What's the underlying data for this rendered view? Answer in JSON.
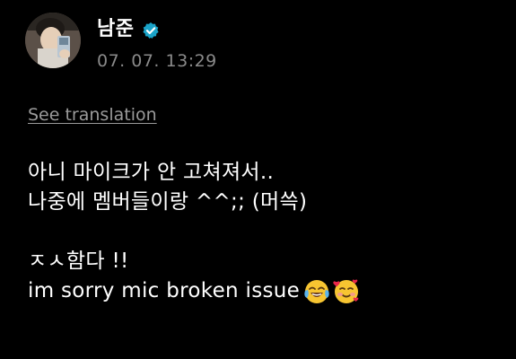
{
  "post": {
    "author_name": "남준",
    "verified": true,
    "timestamp": "07. 07. 13:29",
    "translation_link": "See translation",
    "lines": [
      "아니 마이크가 안 고쳐져서..",
      "나중에 멤버들이랑 ^^;; (머쓱)",
      "",
      "ㅈㅅ함다 !!",
      "im sorry mic broken issue"
    ],
    "emojis": [
      "face-with-tears-of-joy",
      "smiling-face-with-hearts"
    ]
  },
  "colors": {
    "background": "#000000",
    "text": "#ffffff",
    "muted": "#8a8a8a",
    "verified_badge": "#1aa3c8"
  }
}
